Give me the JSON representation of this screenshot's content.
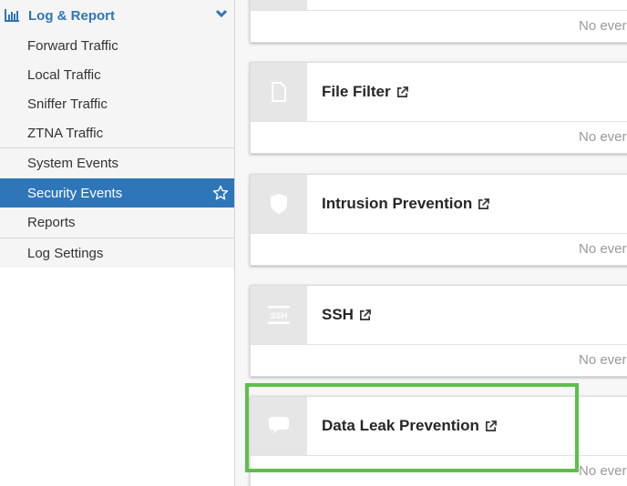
{
  "sidebar": {
    "section": {
      "label": "Log & Report",
      "icon": "bar-chart-icon",
      "expanded_icon": "chevron-down-icon"
    },
    "items": [
      {
        "label": "Forward Traffic"
      },
      {
        "label": "Local Traffic"
      },
      {
        "label": "Sniffer Traffic"
      },
      {
        "label": "ZTNA Traffic"
      },
      {
        "label": "System Events"
      },
      {
        "label": "Security Events",
        "active": true,
        "icon": "star-outline-icon"
      },
      {
        "label": "Reports"
      },
      {
        "label": "Log Settings"
      }
    ]
  },
  "cards": [
    {
      "title": "",
      "icon": "",
      "footer": "No ever"
    },
    {
      "title": "File Filter",
      "icon": "file-icon",
      "footer": "No ever"
    },
    {
      "title": "Intrusion Prevention",
      "icon": "shield-icon",
      "footer": "No ever"
    },
    {
      "title": "SSH",
      "icon": "ssh-icon",
      "icon_text": "SSH",
      "footer": "No ever"
    },
    {
      "title": "Data Leak Prevention",
      "icon": "speech-bubble-icon",
      "footer": "No ever",
      "highlighted": true
    }
  ],
  "colors": {
    "accent": "#2f76b9",
    "highlight": "#5dbf4a"
  }
}
